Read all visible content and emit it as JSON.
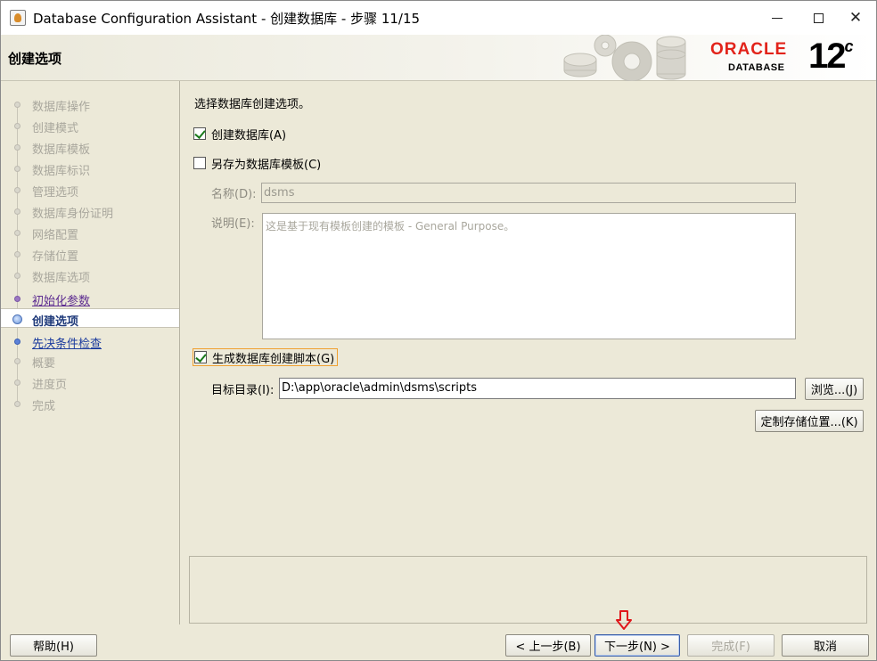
{
  "window": {
    "title": "Database Configuration Assistant - 创建数据库 - 步骤 11/15",
    "minimize_label": "",
    "maximize_label": "",
    "close_label": "✕"
  },
  "header": {
    "title": "创建选项",
    "brand_word": "ORACLE",
    "brand_registered": "®",
    "brand_sub": "DATABASE",
    "version": "12",
    "version_suffix": "c"
  },
  "steps": [
    {
      "label": "数据库操作",
      "state": "done"
    },
    {
      "label": "创建模式",
      "state": "done"
    },
    {
      "label": "数据库模板",
      "state": "done"
    },
    {
      "label": "数据库标识",
      "state": "done"
    },
    {
      "label": "管理选项",
      "state": "done"
    },
    {
      "label": "数据库身份证明",
      "state": "done"
    },
    {
      "label": "网络配置",
      "state": "done"
    },
    {
      "label": "存储位置",
      "state": "done"
    },
    {
      "label": "数据库选项",
      "state": "done"
    },
    {
      "label": "初始化参数",
      "state": "visited"
    },
    {
      "label": "创建选项",
      "state": "current"
    },
    {
      "label": "先决条件检查",
      "state": "next"
    },
    {
      "label": "概要",
      "state": "pending"
    },
    {
      "label": "进度页",
      "state": "pending"
    },
    {
      "label": "完成",
      "state": "pending"
    }
  ],
  "main": {
    "prompt": "选择数据库创建选项。",
    "create_db_label": "创建数据库(A)",
    "create_db_checked": true,
    "save_template_label": "另存为数据库模板(C)",
    "save_template_checked": false,
    "name_label": "名称(D):",
    "name_value": "dsms",
    "desc_label": "说明(E):",
    "desc_value": "这是基于现有模板创建的模板 - General Purpose。",
    "gen_scripts_label": "生成数据库创建脚本(G)",
    "gen_scripts_checked": true,
    "target_dir_label": "目标目录(I):",
    "target_dir_value": "D:\\app\\oracle\\admin\\dsms\\scripts",
    "browse_label": "浏览...(J)",
    "custom_storage_label": "定制存储位置...(K)"
  },
  "footer": {
    "help_label": "帮助(H)",
    "back_label": "< 上一步(B)",
    "next_label": "下一步(N) >",
    "finish_label": "完成(F)",
    "cancel_label": "取消"
  },
  "colors": {
    "oracle_red": "#e2231a",
    "panel_bg": "#ece9d8",
    "visited_link": "#5e2d91",
    "next_link": "#1c3c9e",
    "annotation_arrow": "#e0161b"
  },
  "icons": {
    "app": "java-cup-icon",
    "banner": "gears-database-icon",
    "annotation": "down-arrow-icon"
  }
}
